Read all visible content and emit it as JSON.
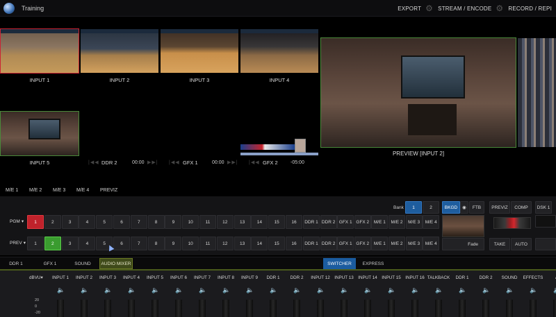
{
  "titlebar": {
    "app_title": "Training",
    "menu": [
      "EXPORT",
      "STREAM / ENCODE",
      "RECORD / REPI"
    ]
  },
  "monitors": [
    {
      "label": "INPUT 1"
    },
    {
      "label": "INPUT 2"
    },
    {
      "label": "INPUT 3"
    },
    {
      "label": "INPUT 4"
    },
    {
      "label": "INPUT 5"
    }
  ],
  "ddr2": {
    "label": "DDR 2",
    "time": "00:00"
  },
  "gfx1": {
    "label": "GFX 1",
    "time": "00:00"
  },
  "gfx2": {
    "label": "GFX 2",
    "time": "-05:00"
  },
  "preview": {
    "label": "PREVIEW [INPUT 2]"
  },
  "me_tabs": [
    "M/E 1",
    "M/E 2",
    "M/E 3",
    "M/E 4",
    "PREVIZ"
  ],
  "switcher": {
    "bank_label": "Bank",
    "bank_buttons": [
      "1",
      "2"
    ],
    "pgm_label": "PGM",
    "prev_label": "PREV",
    "numbers": [
      "1",
      "2",
      "3",
      "4",
      "5",
      "6",
      "7",
      "8",
      "9",
      "10",
      "11",
      "12",
      "13",
      "14",
      "15",
      "16"
    ],
    "sources": [
      "DDR 1",
      "DDR 2",
      "GFX 1",
      "GFX 2",
      "M/E 1",
      "M/E 2",
      "M/E 3",
      "M/E 4"
    ],
    "pgm_active": "1",
    "prev_active": "2",
    "bkgd": "BKGD",
    "ftb": "FTB",
    "fade": "Fade",
    "previz": "PREVIZ",
    "comp": "COMP",
    "take": "TAKE",
    "auto": "AUTO",
    "dsk1": "DSK 1"
  },
  "bottom_tabs": [
    "DDR 1",
    "GFX 1",
    "SOUND",
    "AUDIO MIXER",
    "SWITCHER",
    "EXPRESS"
  ],
  "mixer": {
    "db_label": "dBVU",
    "db_ticks": [
      "20",
      "0",
      "-20"
    ],
    "channels": [
      "INPUT 1",
      "INPUT 2",
      "INPUT 3",
      "INPUT 4",
      "INPUT 5",
      "INPUT 6",
      "INPUT 7",
      "INPUT 8",
      "INPUT 9",
      "DDR 1",
      "DDR 2",
      "INPUT 12",
      "INPUT 13",
      "INPUT 14",
      "INPUT 15",
      "INPUT 16",
      "TALKBACK",
      "DDR 1",
      "DDR 2",
      "SOUND",
      "EFFECTS",
      "A"
    ]
  },
  "colors": {
    "pgm_red": "#c0222b",
    "prev_green": "#3a9c2f",
    "accent_blue": "#1e5d9e",
    "mixer_tab": "#3f4a1a"
  }
}
